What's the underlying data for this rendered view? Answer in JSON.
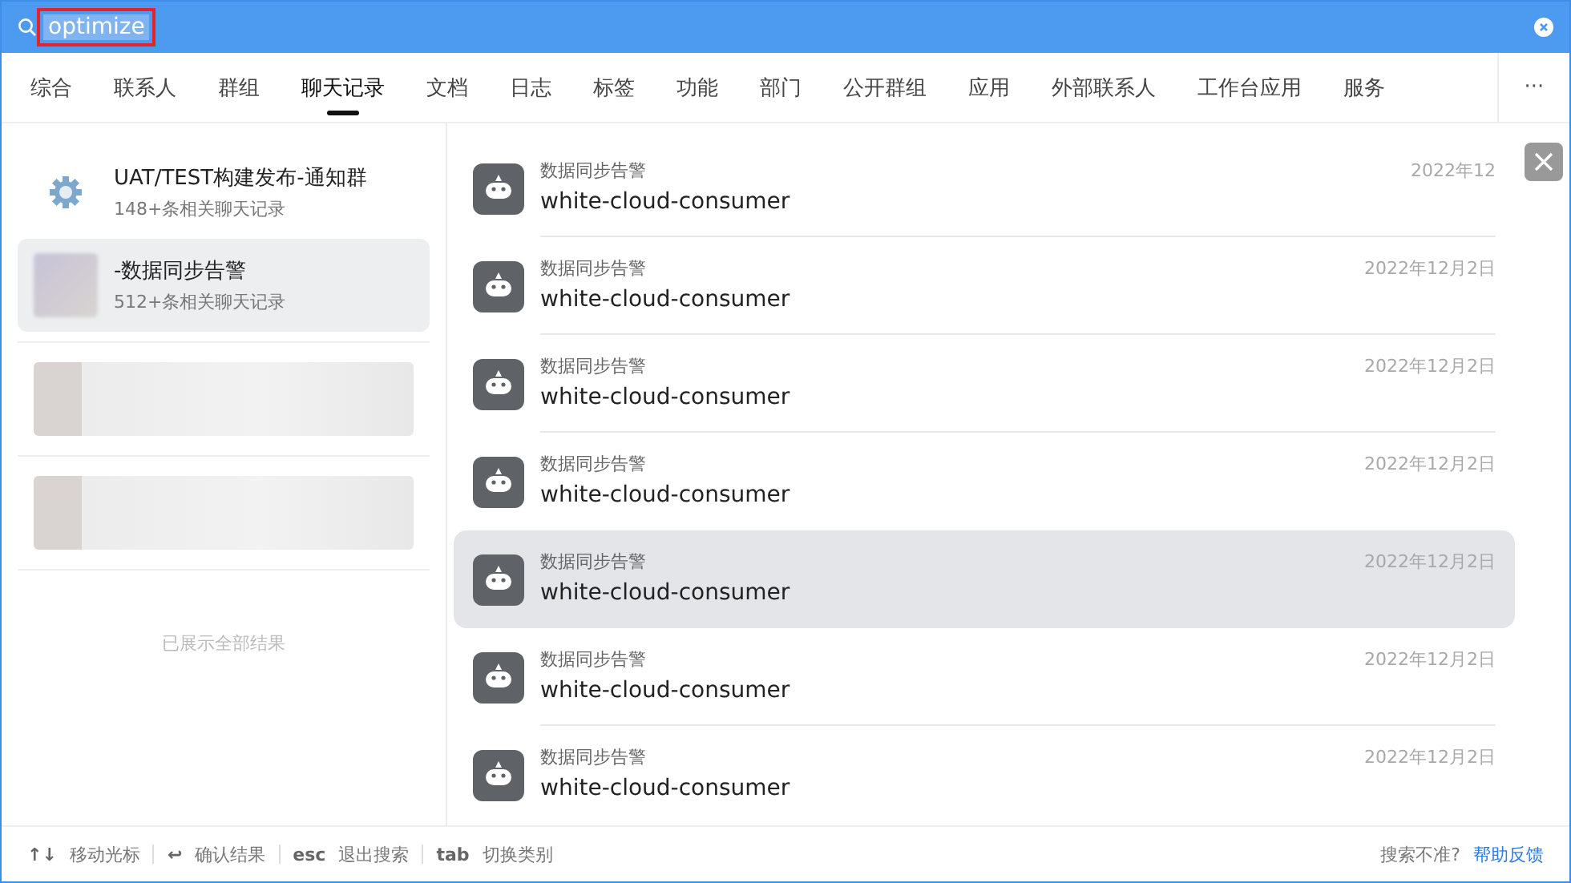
{
  "search": {
    "value": "optimize"
  },
  "tabs": [
    {
      "label": "综合",
      "selected": false
    },
    {
      "label": "联系人",
      "selected": false
    },
    {
      "label": "群组",
      "selected": false
    },
    {
      "label": "聊天记录",
      "selected": true
    },
    {
      "label": "文档",
      "selected": false
    },
    {
      "label": "日志",
      "selected": false
    },
    {
      "label": "标签",
      "selected": false
    },
    {
      "label": "功能",
      "selected": false
    },
    {
      "label": "部门",
      "selected": false
    },
    {
      "label": "公开群组",
      "selected": false
    },
    {
      "label": "应用",
      "selected": false
    },
    {
      "label": "外部联系人",
      "selected": false
    },
    {
      "label": "工作台应用",
      "selected": false
    },
    {
      "label": "服务",
      "selected": false
    }
  ],
  "more": "···",
  "groups": [
    {
      "kind": "gear",
      "title": "UAT/TEST构建发布-通知群",
      "count": "148+条相关聊天记录",
      "selected": false
    },
    {
      "kind": "blurred-avatar",
      "title": "-数据同步告警",
      "count": "512+条相关聊天记录",
      "selected": true
    },
    {
      "kind": "blurred",
      "selected": false
    },
    {
      "kind": "blurred",
      "selected": false
    }
  ],
  "end_note": "已展示全部结果",
  "messages": [
    {
      "sender": "数据同步告警",
      "text": "white-cloud-consumer",
      "date": "2022年12",
      "selected": false
    },
    {
      "sender": "数据同步告警",
      "text": "white-cloud-consumer",
      "date": "2022年12月2日",
      "selected": false
    },
    {
      "sender": "数据同步告警",
      "text": "white-cloud-consumer",
      "date": "2022年12月2日",
      "selected": false
    },
    {
      "sender": "数据同步告警",
      "text": "white-cloud-consumer",
      "date": "2022年12月2日",
      "selected": false
    },
    {
      "sender": "数据同步告警",
      "text": "white-cloud-consumer",
      "date": "2022年12月2日",
      "selected": true
    },
    {
      "sender": "数据同步告警",
      "text": "white-cloud-consumer",
      "date": "2022年12月2日",
      "selected": false
    },
    {
      "sender": "数据同步告警",
      "text": "white-cloud-consumer",
      "date": "2022年12月2日",
      "selected": false
    }
  ],
  "footer": {
    "hints": [
      {
        "key": "↑↓",
        "label": "移动光标"
      },
      {
        "key": "↩",
        "label": "确认结果"
      },
      {
        "key": "esc",
        "label": "退出搜索"
      },
      {
        "key": "tab",
        "label": "切换类别"
      }
    ],
    "question": "搜索不准?",
    "link": "帮助反馈"
  }
}
